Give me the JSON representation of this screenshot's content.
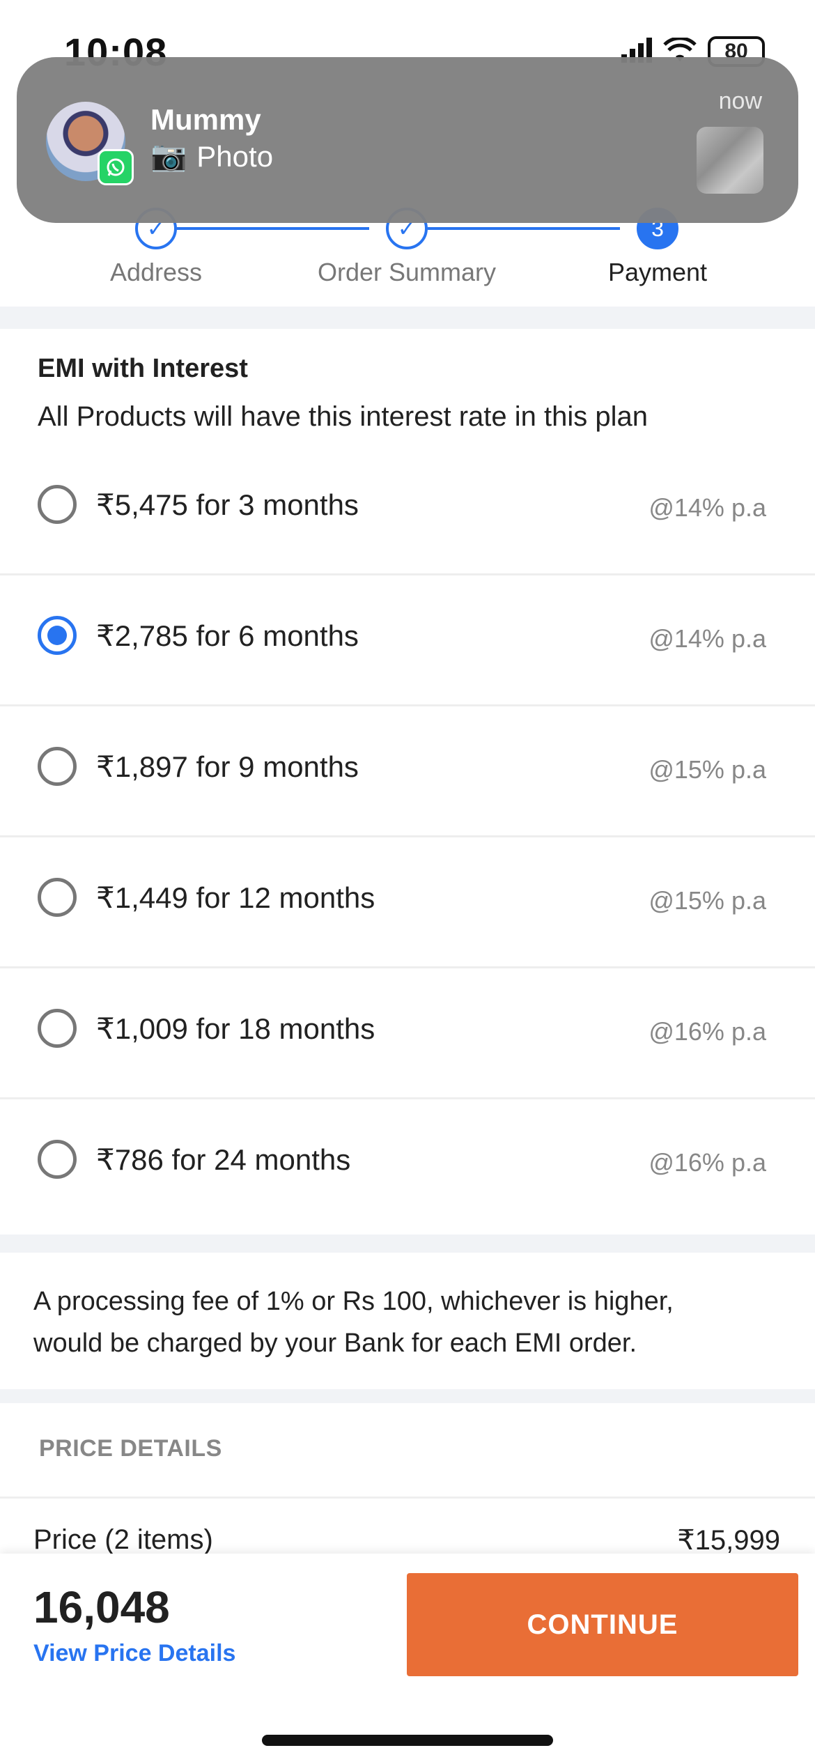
{
  "status_bar": {
    "time": "10:08",
    "battery": "80"
  },
  "notification": {
    "sender": "Mummy",
    "message": "Photo",
    "time": "now",
    "app_badge_icon": "whatsapp-icon",
    "camera_glyph": "📷"
  },
  "stepper": {
    "steps": [
      {
        "label": "Address",
        "state": "done",
        "marker": "✓"
      },
      {
        "label": "Order Summary",
        "state": "done",
        "marker": "✓"
      },
      {
        "label": "Payment",
        "state": "active",
        "marker": "3"
      }
    ]
  },
  "emi": {
    "title": "EMI with Interest",
    "subtitle": "All Products will have this interest rate in this plan",
    "options": [
      {
        "label": "₹5,475 for 3 months",
        "rate": "@14% p.a",
        "selected": false
      },
      {
        "label": "₹2,785 for 6 months",
        "rate": "@14% p.a",
        "selected": true
      },
      {
        "label": "₹1,897 for 9 months",
        "rate": "@15% p.a",
        "selected": false
      },
      {
        "label": "₹1,449 for 12 months",
        "rate": "@15% p.a",
        "selected": false
      },
      {
        "label": "₹1,009 for 18 months",
        "rate": "@16% p.a",
        "selected": false
      },
      {
        "label": "₹786 for 24 months",
        "rate": "@16% p.a",
        "selected": false
      }
    ]
  },
  "processing_fee": {
    "line1": "A processing fee of 1% or Rs 100, whichever is higher,",
    "line2": "would be charged by your Bank for each EMI order."
  },
  "price_details": {
    "header": "PRICE DETAILS",
    "row_label": "Price (2 items)",
    "row_value": "₹15,999"
  },
  "bottom_bar": {
    "total": "16,048",
    "view_details": "View Price Details",
    "continue_label": "CONTINUE"
  },
  "colors": {
    "accent": "#2874f0",
    "cta": "#e96e36"
  }
}
